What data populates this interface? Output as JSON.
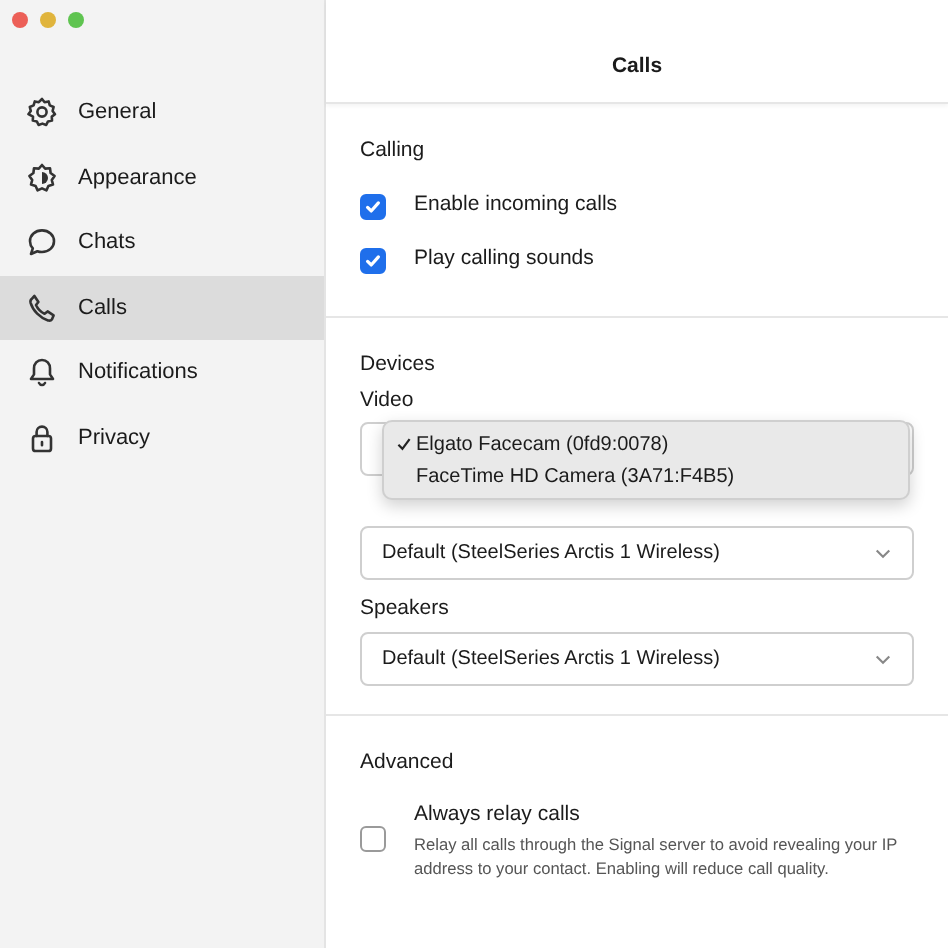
{
  "window": {
    "title": "Calls"
  },
  "sidebar": {
    "items": [
      {
        "label": "General",
        "selected": false
      },
      {
        "label": "Appearance",
        "selected": false
      },
      {
        "label": "Chats",
        "selected": false
      },
      {
        "label": "Calls",
        "selected": true
      },
      {
        "label": "Notifications",
        "selected": false
      },
      {
        "label": "Privacy",
        "selected": false
      }
    ]
  },
  "calling": {
    "heading": "Calling",
    "options": [
      {
        "label": "Enable incoming calls",
        "checked": true
      },
      {
        "label": "Play calling sounds",
        "checked": true
      }
    ]
  },
  "devices": {
    "heading": "Devices",
    "video": {
      "label": "Video",
      "menu": [
        {
          "label": "Elgato Facecam (0fd9:0078)",
          "selected": true
        },
        {
          "label": "FaceTime HD Camera (3A71:F4B5)",
          "selected": false
        }
      ]
    },
    "microphone": {
      "value": "Default (SteelSeries Arctis 1 Wireless)"
    },
    "speakers": {
      "label": "Speakers",
      "value": "Default (SteelSeries Arctis 1 Wireless)"
    }
  },
  "advanced": {
    "heading": "Advanced",
    "option": {
      "label": "Always relay calls",
      "description": "Relay all calls through the Signal server to avoid revealing your IP address to your contact. Enabling will reduce call quality.",
      "checked": false
    }
  }
}
